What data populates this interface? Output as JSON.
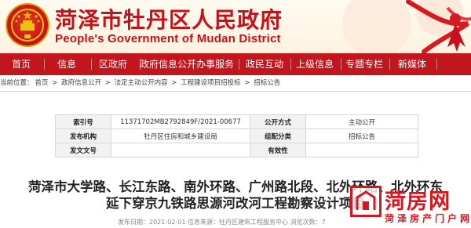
{
  "header": {
    "title": "菏泽市牡丹区人民政府",
    "subtitle": "People's Government of Mudan District",
    "colors": {
      "brand_red": "#c1161d",
      "title_red": "#c8101a",
      "emblem_gold": "#f2c10e"
    }
  },
  "nav": {
    "items": [
      "首页",
      "信息",
      "区政府",
      "政府信息公开",
      "办事服务",
      "政民互动",
      "上级信息",
      "专题专栏",
      "新媒体"
    ]
  },
  "breadcrumb": {
    "prefix": "当前位置：",
    "items": [
      "首页",
      "政府信息公开",
      "法定主动公开内容",
      "工程建设项目招投标",
      "招标公告"
    ],
    "separator": " > "
  },
  "info_table": {
    "rows": [
      [
        "索引号",
        "11371702MB2792849F/2021-00677",
        "公开方式",
        "主动公开"
      ],
      [
        "发布机构",
        "牡丹区住房和城乡建设局",
        "组配分类",
        "招标公告"
      ],
      [
        "发文文号",
        "",
        "有效性",
        ""
      ]
    ]
  },
  "article": {
    "title_line1": "菏泽市大学路、长江东路、南外环路、广州路北段、北外环路、北外环东",
    "title_line2": "延下穿京九铁路思源河改河工程勘察设计项目",
    "meta": "发布日期：2021-02-01    信息来源：牡丹区建筑工程服务中心    浏览次数：7"
  },
  "watermark": {
    "brand": "菏房网",
    "sub": "菏泽房产门户网站"
  }
}
